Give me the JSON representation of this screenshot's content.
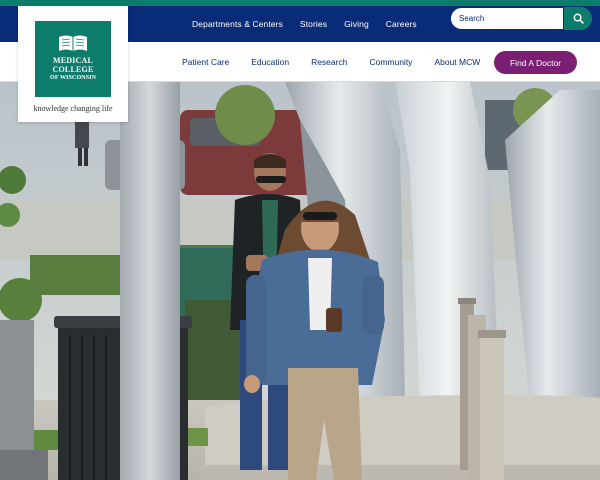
{
  "colors": {
    "primary_navy": "#0a2c78",
    "accent_green": "#0e7c6b",
    "cta_purple": "#7a1f73"
  },
  "logo": {
    "line1": "MEDICAL",
    "line2": "COLLEGE",
    "line3": "OF WISCONSIN",
    "tagline": "knowledge changing life",
    "icon": "open-book-icon"
  },
  "utility_nav": {
    "items": [
      "Departments & Centers",
      "Stories",
      "Giving",
      "Careers"
    ]
  },
  "search": {
    "placeholder": "Search",
    "button_icon": "search-icon"
  },
  "main_nav": {
    "items": [
      "Patient Care",
      "Education",
      "Research",
      "Community",
      "About MCW"
    ]
  },
  "cta": {
    "label": "Find A Doctor"
  },
  "hero": {
    "description": "photo-of-two-people-walking-past-sculptures"
  }
}
